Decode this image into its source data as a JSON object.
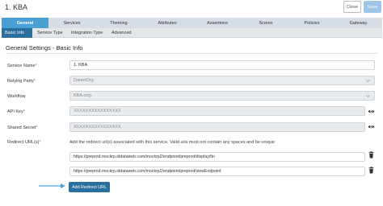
{
  "header": {
    "title": "1. KBA",
    "close_label": "Close",
    "save_label": "Save"
  },
  "tabs": [
    "General",
    "Services",
    "Theming",
    "Attributes",
    "Assertions",
    "Scores",
    "Policies",
    "Gateway"
  ],
  "active_tab": "General",
  "subtabs": [
    "Basic Info",
    "Service Type",
    "Integration Type",
    "Advanced"
  ],
  "active_subtab": "Basic Info",
  "section": {
    "title": "General Settings - Basic Info"
  },
  "form": {
    "service_name": {
      "label": "Service Name",
      "required": "*",
      "value": "1. KBA"
    },
    "relying_party": {
      "label": "Relying Party",
      "required": "*",
      "value": "DanielOrg"
    },
    "workflow": {
      "label": "Workflow",
      "value": "KBA only"
    },
    "api_key": {
      "label": "API Key",
      "required": "*",
      "value": "XXXXXXXXXXXXXXXX"
    },
    "shared_secret": {
      "label": "Shared Secret",
      "required": "*",
      "value": "XXXXXXXXXXXXXXXX"
    },
    "redirect_urls": {
      "label": "Redirect URL(s)",
      "required": "*",
      "hint": "Add the redirect url(s) associated with this service. Valid urls must not contain any spaces and be unique",
      "values": [
        "https://preprod.mockrp.iddataweb.com/mockrp2/endpoint/preprod/display/fin",
        "https://preprod.mockrp.iddataweb.com/mockrp2/endpoint/preprod/viewEndpoint"
      ],
      "add_button_label": "Add Redirect URL"
    }
  },
  "icons": {
    "reveal": "eye-icon",
    "delete": "trash-icon",
    "dropdown": "chevron-down-icon",
    "pointer": "arrow-right-icon"
  },
  "colors": {
    "primary": "#2a6f9e",
    "tab_active": "#4a9fd3",
    "save_disabled": "#9ec5e8",
    "required": "#d9534f"
  }
}
